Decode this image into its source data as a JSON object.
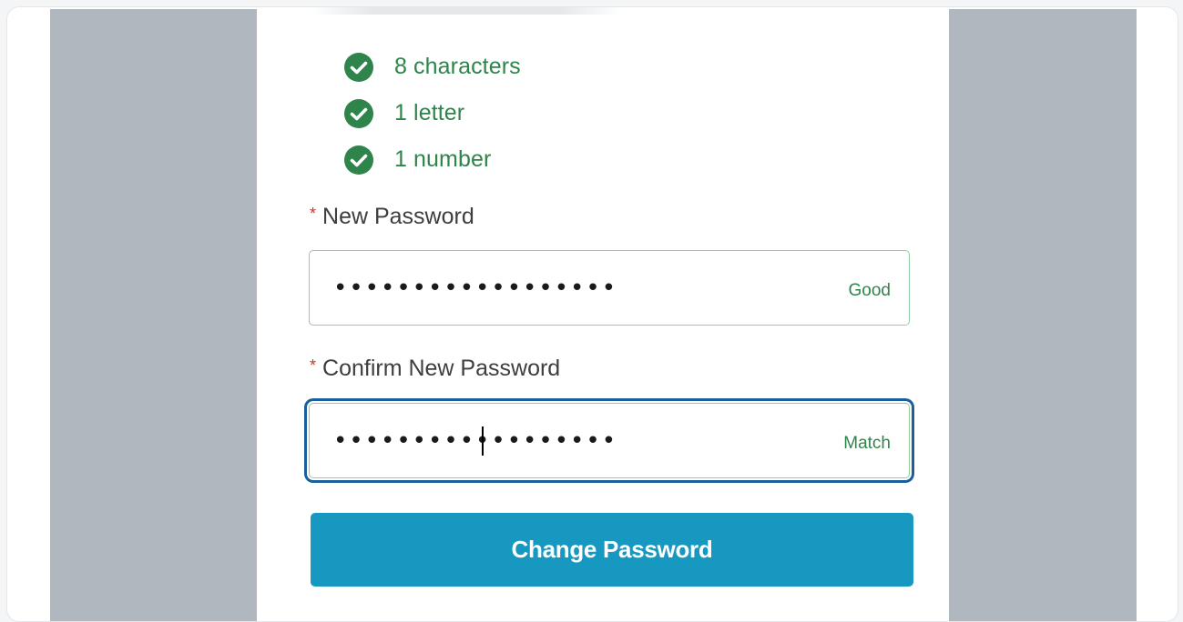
{
  "requirements": [
    {
      "label": "8 characters",
      "icon": "check-circle-icon",
      "met": true
    },
    {
      "label": "1 letter",
      "icon": "check-circle-icon",
      "met": true
    },
    {
      "label": "1 number",
      "icon": "check-circle-icon",
      "met": true
    }
  ],
  "new_password": {
    "required_marker": "*",
    "label": "New Password",
    "value": "••••••••••••••••••",
    "strength": "Good"
  },
  "confirm_password": {
    "required_marker": "*",
    "label": "Confirm New Password",
    "value": "••••••••••••••••••",
    "match_status": "Match"
  },
  "submit": {
    "label": "Change Password"
  },
  "colors": {
    "success": "#2e844a",
    "check_fill": "#2e844a",
    "primary_button": "#1798c1",
    "focus_ring": "#1b5e9c",
    "required": "#c23934",
    "backdrop": "#b0b7bf"
  }
}
